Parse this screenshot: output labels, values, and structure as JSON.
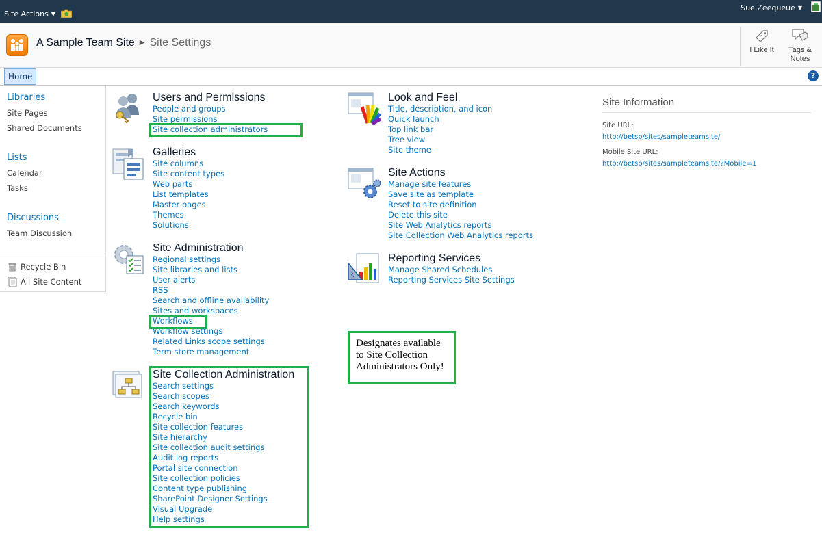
{
  "topbar": {
    "site_actions": "Site Actions",
    "user_name": "Sue Zeequeue"
  },
  "title_area": {
    "site_name": "A Sample Team Site",
    "page_name": "Site Settings",
    "i_like_it": "I Like It",
    "tags_notes_1": "Tags &",
    "tags_notes_2": "Notes"
  },
  "topnav": {
    "home": "Home",
    "help": "?"
  },
  "quicklaunch": {
    "libraries": "Libraries",
    "site_pages": "Site Pages",
    "shared_documents": "Shared Documents",
    "lists": "Lists",
    "calendar": "Calendar",
    "tasks": "Tasks",
    "discussions": "Discussions",
    "team_discussion": "Team Discussion",
    "recycle_bin": "Recycle Bin",
    "all_site_content": "All Site Content"
  },
  "groups": {
    "users": {
      "title": "Users and Permissions",
      "links": [
        "People and groups",
        "Site permissions",
        "Site collection administrators"
      ]
    },
    "galleries": {
      "title": "Galleries",
      "links": [
        "Site columns",
        "Site content types",
        "Web parts",
        "List templates",
        "Master pages",
        "Themes",
        "Solutions"
      ]
    },
    "admin": {
      "title": "Site Administration",
      "links": [
        "Regional settings",
        "Site libraries and lists",
        "User alerts",
        "RSS",
        "Search and offline availability",
        "Sites and workspaces",
        "Workflows",
        "Workflow settings",
        "Related Links scope settings",
        "Term store management"
      ]
    },
    "sca": {
      "title": "Site Collection Administration",
      "links": [
        "Search settings",
        "Search scopes",
        "Search keywords",
        "Recycle bin",
        "Site collection features",
        "Site hierarchy",
        "Site collection audit settings",
        "Audit log reports",
        "Portal site connection",
        "Site collection policies",
        "Content type publishing",
        "SharePoint Designer Settings",
        "Visual Upgrade",
        "Help settings"
      ]
    },
    "look": {
      "title": "Look and Feel",
      "links": [
        "Title, description, and icon",
        "Quick launch",
        "Top link bar",
        "Tree view",
        "Site theme"
      ]
    },
    "actions": {
      "title": "Site Actions",
      "links": [
        "Manage site features",
        "Save site as template",
        "Reset to site definition",
        "Delete this site",
        "Site Web Analytics reports",
        "Site Collection Web Analytics reports"
      ]
    },
    "reporting": {
      "title": "Reporting Services",
      "links": [
        "Manage Shared Schedules",
        "Reporting Services Site Settings"
      ]
    }
  },
  "site_info": {
    "title": "Site Information",
    "site_url_label": "Site URL:",
    "site_url": "http://betsp/sites/sampleteamsite/",
    "mobile_url_label": "Mobile Site URL:",
    "mobile_url": "http://betsp/sites/sampleteamsite/?Mobile=1"
  },
  "annotation": {
    "line1": "Designates available",
    "line2": "to Site Collection",
    "line3": "Administrators Only!"
  },
  "colors": {
    "topbar_bg": "#21374c",
    "link": "#0072bc",
    "annotation_green": "#22b04c"
  }
}
